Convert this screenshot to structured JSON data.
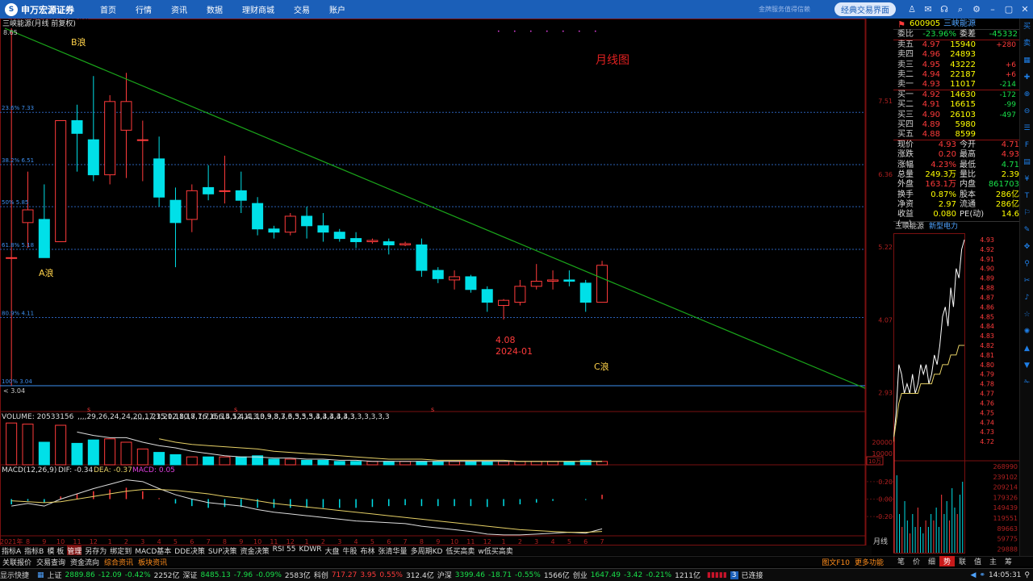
{
  "app": {
    "logo": "申万宏源证券",
    "menu": [
      "首页",
      "行情",
      "资讯",
      "数据",
      "理财商城",
      "交易",
      "账户"
    ],
    "slogan": "金牌服务值得信赖",
    "classic": "经典交易界面"
  },
  "chart_title": "三峡能源(月线 前复权)",
  "chart_data": {
    "type": "candlestick",
    "period": "月线",
    "annotation": "月线图",
    "wave_labels": [
      "B浪",
      "A浪",
      "C浪"
    ],
    "low_label": "4.08",
    "low_date": "2024-01",
    "high_mark": "8.65",
    "low_mark": "3.04",
    "fib_levels": [
      {
        "label": "23.6% 7.33",
        "value": 7.33
      },
      {
        "label": "38.2% 6.51",
        "value": 6.51
      },
      {
        "label": "50% 5.85",
        "value": 5.85
      },
      {
        "label": "61.8% 5.18",
        "value": 5.18
      },
      {
        "label": "80.9% 4.11",
        "value": 4.11
      },
      {
        "label": "100% 3.04",
        "value": 3.04
      }
    ],
    "y_ticks": [
      "7.51",
      "6.36",
      "5.22",
      "4.07",
      "2.93"
    ],
    "ylim": [
      2.85,
      8.65
    ],
    "x_ticks": [
      "2021年",
      "8",
      "9",
      "10",
      "11",
      "12",
      "1",
      "2",
      "3",
      "4",
      "5",
      "6",
      "7",
      "8",
      "9",
      "10",
      "11",
      "12",
      "1",
      "2",
      "3",
      "4",
      "5",
      "6",
      "7",
      "8",
      "9",
      "10",
      "11",
      "12",
      "1",
      "2",
      "3",
      "4",
      "5",
      "6",
      "7"
    ],
    "candles": [
      {
        "o": 5.05,
        "h": 8.65,
        "l": 3.04,
        "c": 5.05
      },
      {
        "o": 5.6,
        "h": 6.4,
        "l": 5.2,
        "c": 5.8
      },
      {
        "o": 5.65,
        "h": 6.2,
        "l": 5.2,
        "c": 5.05
      },
      {
        "o": 5.3,
        "h": 7.2,
        "l": 5.3,
        "c": 7.2
      },
      {
        "o": 7.2,
        "h": 7.45,
        "l": 6.4,
        "c": 7.0
      },
      {
        "o": 6.9,
        "h": 7.9,
        "l": 6.25,
        "c": 6.35
      },
      {
        "o": 6.35,
        "h": 7.6,
        "l": 6.2,
        "c": 7.5
      },
      {
        "o": 7.05,
        "h": 7.95,
        "l": 6.3,
        "c": 7.5
      },
      {
        "o": 6.9,
        "h": 7.2,
        "l": 6.25,
        "c": 6.9
      },
      {
        "o": 6.6,
        "h": 6.95,
        "l": 5.85,
        "c": 6.0
      },
      {
        "o": 5.95,
        "h": 6.15,
        "l": 4.9,
        "c": 5.6
      },
      {
        "o": 5.65,
        "h": 6.2,
        "l": 5.45,
        "c": 6.1
      },
      {
        "o": 6.15,
        "h": 6.5,
        "l": 5.95,
        "c": 6.05
      },
      {
        "o": 6.1,
        "h": 6.65,
        "l": 5.9,
        "c": 6.1
      },
      {
        "o": 6.1,
        "h": 6.4,
        "l": 5.75,
        "c": 5.95
      },
      {
        "o": 5.9,
        "h": 6.0,
        "l": 5.4,
        "c": 5.5
      },
      {
        "o": 5.5,
        "h": 5.55,
        "l": 5.35,
        "c": 5.45
      },
      {
        "o": 5.45,
        "h": 5.75,
        "l": 5.4,
        "c": 5.7
      },
      {
        "o": 5.7,
        "h": 5.85,
        "l": 5.35,
        "c": 5.55
      },
      {
        "o": 5.55,
        "h": 5.75,
        "l": 5.3,
        "c": 5.45
      },
      {
        "o": 5.45,
        "h": 5.5,
        "l": 5.3,
        "c": 5.35
      },
      {
        "o": 5.35,
        "h": 5.45,
        "l": 5.2,
        "c": 5.3
      },
      {
        "o": 5.3,
        "h": 5.35,
        "l": 5.27,
        "c": 5.32
      },
      {
        "o": 5.3,
        "h": 5.35,
        "l": 5.1,
        "c": 5.25
      },
      {
        "o": 5.25,
        "h": 5.3,
        "l": 5.23,
        "c": 5.27
      },
      {
        "o": 5.25,
        "h": 5.35,
        "l": 4.75,
        "c": 4.85
      },
      {
        "o": 4.85,
        "h": 4.9,
        "l": 4.65,
        "c": 4.72
      },
      {
        "o": 4.7,
        "h": 4.85,
        "l": 4.55,
        "c": 4.75
      },
      {
        "o": 4.75,
        "h": 4.78,
        "l": 4.5,
        "c": 4.55
      },
      {
        "o": 4.55,
        "h": 4.6,
        "l": 4.2,
        "c": 4.35
      },
      {
        "o": 4.3,
        "h": 4.4,
        "l": 4.08,
        "c": 4.38
      },
      {
        "o": 4.35,
        "h": 4.7,
        "l": 4.3,
        "c": 4.6
      },
      {
        "o": 4.6,
        "h": 4.95,
        "l": 4.55,
        "c": 4.68
      },
      {
        "o": 4.68,
        "h": 4.85,
        "l": 4.55,
        "c": 4.7
      },
      {
        "o": 4.7,
        "h": 4.85,
        "l": 4.6,
        "c": 4.68
      },
      {
        "o": 4.65,
        "h": 4.7,
        "l": 4.2,
        "c": 4.35
      },
      {
        "o": 4.35,
        "h": 5.0,
        "l": 4.35,
        "c": 4.93
      }
    ],
    "trendline": {
      "from": {
        "x": "2021年",
        "y": 8.65
      },
      "to_right_edge": 3.0
    },
    "volume": {
      "header": "VOLUME: 20533156",
      "ma5": [
        null,
        null,
        null,
        null,
        29,
        26,
        24,
        24,
        20,
        17,
        15,
        12,
        10,
        8,
        7,
        7,
        6,
        6,
        5,
        5,
        4,
        4,
        3,
        3,
        3,
        3,
        3,
        3,
        3,
        3,
        3,
        3,
        3,
        3,
        3,
        3,
        3
      ],
      "ma10": [
        null,
        null,
        null,
        null,
        null,
        null,
        null,
        null,
        null,
        23,
        20,
        18,
        17,
        16,
        15,
        14,
        12,
        11,
        10,
        9,
        8,
        7,
        6,
        5,
        5,
        5,
        4,
        4,
        4,
        4,
        4,
        3,
        3,
        3,
        3,
        3,
        3
      ],
      "unit": "10万",
      "y_ticks": [
        "20000",
        "10000"
      ],
      "values": [
        37,
        36,
        20,
        35,
        19,
        22,
        23,
        20,
        14,
        11,
        9,
        7,
        7,
        7,
        7,
        8,
        5,
        5,
        4,
        4,
        3,
        3,
        3,
        3,
        3,
        3,
        3,
        3,
        3,
        3,
        3,
        3,
        3,
        3,
        3,
        4,
        3
      ]
    },
    "macd": {
      "header": "MACD(12,26,9)",
      "dif": "DIF: -0.34",
      "dea": "DEA: -0.37",
      "macd": "MACD: 0.05",
      "y_ticks": [
        "0.20",
        "0.00",
        "-0.20"
      ],
      "ylim": [
        -0.42,
        0.3
      ],
      "dif_values": [
        -0.08,
        -0.05,
        -0.08,
        0.0,
        0.06,
        0.12,
        0.17,
        0.22,
        0.2,
        0.12,
        0.05,
        0.0,
        -0.04,
        -0.06,
        -0.08,
        -0.12,
        -0.15,
        -0.17,
        -0.19,
        -0.21,
        -0.23,
        -0.25,
        -0.26,
        -0.27,
        -0.28,
        -0.31,
        -0.33,
        -0.35,
        -0.37,
        -0.4,
        -0.41,
        -0.41,
        -0.4,
        -0.39,
        -0.38,
        -0.39,
        -0.34
      ],
      "dea_values": [
        -0.02,
        -0.03,
        -0.04,
        -0.03,
        0.0,
        0.03,
        0.06,
        0.09,
        0.11,
        0.11,
        0.1,
        0.08,
        0.06,
        0.03,
        0.01,
        -0.02,
        -0.05,
        -0.07,
        -0.09,
        -0.11,
        -0.13,
        -0.15,
        -0.17,
        -0.19,
        -0.21,
        -0.23,
        -0.25,
        -0.27,
        -0.29,
        -0.31,
        -0.33,
        -0.35,
        -0.36,
        -0.37,
        -0.38,
        -0.38,
        -0.37
      ],
      "bars": [
        -0.06,
        -0.02,
        -0.04,
        0.03,
        0.06,
        0.09,
        0.11,
        0.13,
        0.09,
        0.01,
        -0.05,
        -0.08,
        -0.1,
        -0.09,
        -0.09,
        -0.1,
        -0.1,
        -0.1,
        -0.1,
        -0.1,
        -0.1,
        -0.1,
        -0.09,
        -0.08,
        -0.07,
        -0.08,
        -0.08,
        -0.08,
        -0.08,
        -0.09,
        -0.08,
        -0.06,
        -0.04,
        -0.02,
        0.0,
        -0.01,
        0.05
      ]
    },
    "intraday": {
      "prices": [
        4.72,
        4.75,
        4.8,
        4.79,
        4.77,
        4.78,
        4.77,
        4.79,
        4.77,
        4.78,
        4.8,
        4.79,
        4.8,
        4.78,
        4.79,
        4.81,
        4.8,
        4.82,
        4.85,
        4.86,
        4.84,
        4.88,
        4.86,
        4.9,
        4.89,
        4.92,
        4.93
      ],
      "avg": [
        4.72,
        4.74,
        4.76,
        4.77,
        4.77,
        4.77,
        4.77,
        4.77,
        4.77,
        4.77,
        4.78,
        4.78,
        4.78,
        4.78,
        4.78,
        4.79,
        4.79,
        4.79,
        4.8,
        4.8,
        4.8,
        4.81,
        4.81,
        4.81,
        4.82,
        4.82,
        4.82
      ],
      "ylim": [
        4.71,
        4.93
      ],
      "y_ticks": [
        "4.93",
        "4.92",
        "4.91",
        "4.90",
        "4.89",
        "4.88",
        "4.87",
        "4.86",
        "4.85",
        "4.84",
        "4.83",
        "4.82",
        "4.81",
        "4.80",
        "4.79",
        "4.78",
        "4.77",
        "4.76",
        "4.75",
        "4.74",
        "4.73",
        "4.72"
      ],
      "vol_ticks": [
        "268990",
        "239102",
        "209214",
        "179326",
        "149439",
        "119551",
        "89663",
        "59775",
        "29888"
      ],
      "vol": [
        90,
        60,
        30,
        20,
        40,
        25,
        15,
        30,
        20,
        35,
        20,
        15,
        25,
        20,
        30,
        25,
        35,
        20,
        45,
        30,
        40,
        25,
        50,
        35,
        30,
        45,
        55
      ]
    }
  },
  "quote": {
    "code": "600905",
    "name": "三峡能源",
    "wb": {
      "k1": "委比",
      "v1": "-23.96%",
      "k2": "委差",
      "v2": "-45332"
    },
    "sells": [
      {
        "l": "卖五",
        "p": "4.97",
        "v": "15940",
        "c": "+280"
      },
      {
        "l": "卖四",
        "p": "4.96",
        "v": "24893",
        "c": ""
      },
      {
        "l": "卖三",
        "p": "4.95",
        "v": "43222",
        "c": "+6"
      },
      {
        "l": "卖二",
        "p": "4.94",
        "v": "22187",
        "c": "+6"
      },
      {
        "l": "卖一",
        "p": "4.93",
        "v": "11017",
        "c": "-214"
      }
    ],
    "buys": [
      {
        "l": "买一",
        "p": "4.92",
        "v": "14630",
        "c": "-172"
      },
      {
        "l": "买二",
        "p": "4.91",
        "v": "16615",
        "c": "-99"
      },
      {
        "l": "买三",
        "p": "4.90",
        "v": "26103",
        "c": "-497"
      },
      {
        "l": "买四",
        "p": "4.89",
        "v": "5980",
        "c": ""
      },
      {
        "l": "买五",
        "p": "4.88",
        "v": "8599",
        "c": ""
      }
    ],
    "stats": [
      [
        "现价",
        "4.93",
        "今开",
        "4.71"
      ],
      [
        "涨跌",
        "0.20",
        "最高",
        "4.93"
      ],
      [
        "涨幅",
        "4.23%",
        "最低",
        "4.71"
      ],
      [
        "总量",
        "249.3万",
        "量比",
        "2.39"
      ],
      [
        "外盘",
        "163.1万",
        "内盘",
        "861703"
      ],
      [
        "换手",
        "0.87%",
        "股本",
        "286亿"
      ],
      [
        "净资",
        "2.97",
        "流通",
        "286亿"
      ],
      [
        "收益(一)",
        "0.080",
        "PE(动)",
        "14.6"
      ]
    ],
    "intraday_tab": "三峡能源",
    "intraday_tab2": "新型电力"
  },
  "indicator_tabs": [
    "指标A",
    "指标B",
    "模 板",
    "管理",
    "另存为",
    "绑定到",
    "MACD基本",
    "DDE决策",
    "SUP决策",
    "资金决策",
    "RSI 55",
    "KDWR",
    "大盘",
    "牛股",
    "布林",
    "张清华量",
    "多周期KD",
    "低买高卖",
    "w低买高卖"
  ],
  "period_label": "月线",
  "bottom_tabs": [
    "关联报价",
    "交易查询",
    "资金流向",
    "综合资讯",
    "板块资讯"
  ],
  "bottom_right": [
    "图文F10",
    "更多功能"
  ],
  "mini_tabs": [
    "笔",
    "价",
    "细",
    "势",
    "联",
    "值",
    "主",
    "筹"
  ],
  "status": {
    "sh": "上证",
    "sh_v": "2889.86",
    "sh_c": "-12.09",
    "sh_p": "-0.42%",
    "sh_a": "2252亿",
    "sz": "深证",
    "sz_v": "8485.13",
    "sz_c": "-7.96",
    "sz_p": "-0.09%",
    "sz_a": "2583亿",
    "kc": "科创",
    "kc_v": "717.27",
    "kc_c": "3.95",
    "kc_p": "0.55%",
    "kc_a": "312.4亿",
    "hs": "沪深",
    "hs_v": "3399.46",
    "hs_c": "-18.71",
    "hs_p": "-0.55%",
    "hs_a": "1566亿",
    "cy": "创业",
    "cy_v": "1647.49",
    "cy_c": "-3.42",
    "cy_p": "-0.21%",
    "cy_a": "1211亿",
    "conn": "已连接",
    "time": "14:05:31",
    "show": "显示快捷"
  }
}
